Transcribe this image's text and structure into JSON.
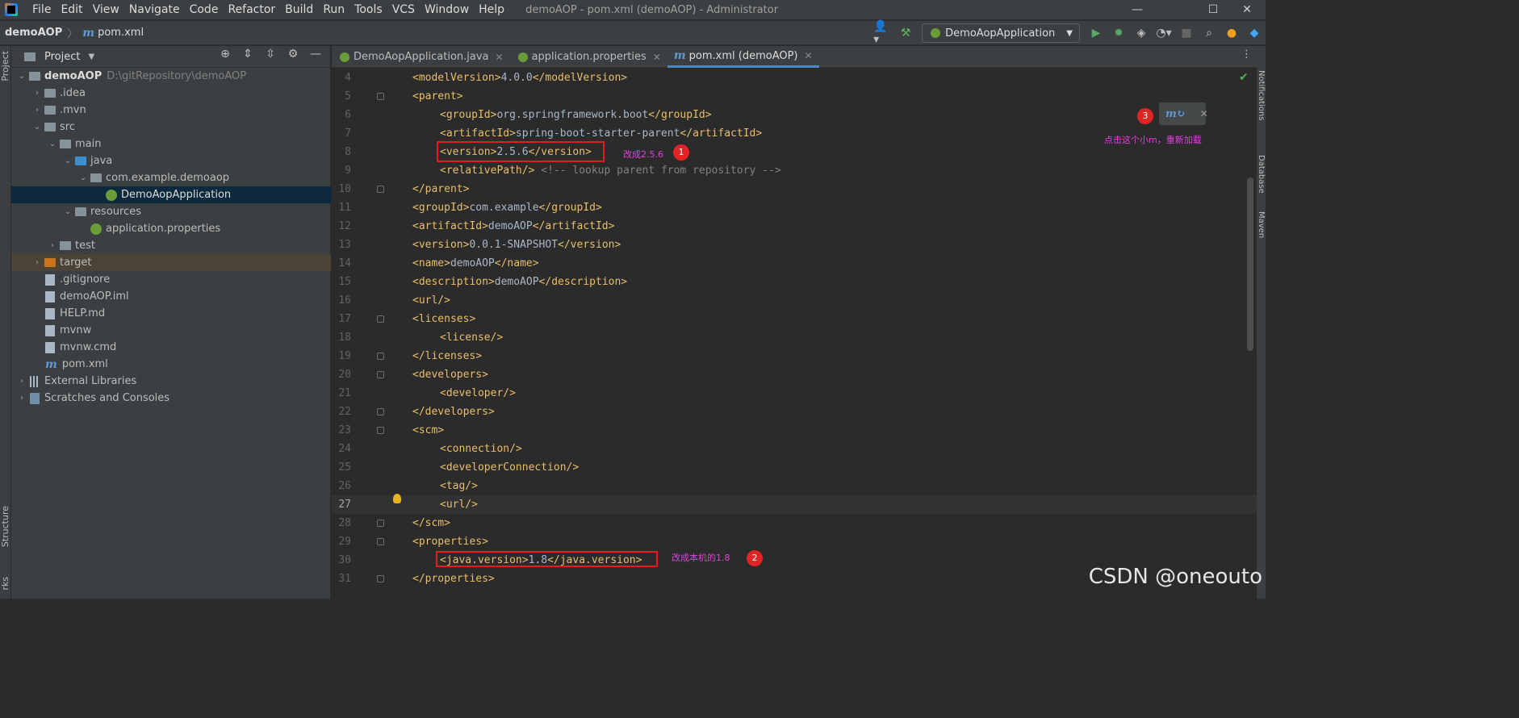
{
  "menubar": {
    "items": [
      "File",
      "Edit",
      "View",
      "Navigate",
      "Code",
      "Refactor",
      "Build",
      "Run",
      "Tools",
      "VCS",
      "Window",
      "Help"
    ],
    "window_title": "demoAOP - pom.xml (demoAOP) - Administrator",
    "minimize": "—",
    "maximize": "☐",
    "close": "✕"
  },
  "navbar": {
    "project": "demoAOP",
    "file": "pom.xml",
    "run_config": "DemoAopApplication"
  },
  "project_panel": {
    "title": "Project",
    "tree": [
      {
        "label": "demoAOP",
        "hint": "D:\\gitRepository\\demoAOP",
        "depth": 0,
        "arrow": "down",
        "icon": "folder"
      },
      {
        "label": ".idea",
        "depth": 1,
        "arrow": "right",
        "icon": "folder"
      },
      {
        "label": ".mvn",
        "depth": 1,
        "arrow": "right",
        "icon": "folder"
      },
      {
        "label": "src",
        "depth": 1,
        "arrow": "down",
        "icon": "folder"
      },
      {
        "label": "main",
        "depth": 2,
        "arrow": "down",
        "icon": "folder"
      },
      {
        "label": "java",
        "depth": 3,
        "arrow": "down",
        "icon": "folder-blue"
      },
      {
        "label": "com.example.demoaop",
        "depth": 4,
        "arrow": "down",
        "icon": "folder"
      },
      {
        "label": "DemoAopApplication",
        "depth": 5,
        "arrow": "",
        "icon": "spring",
        "selected": true
      },
      {
        "label": "resources",
        "depth": 3,
        "arrow": "down",
        "icon": "folder"
      },
      {
        "label": "application.properties",
        "depth": 4,
        "arrow": "",
        "icon": "spring"
      },
      {
        "label": "test",
        "depth": 2,
        "arrow": "right",
        "icon": "folder"
      },
      {
        "label": "target",
        "depth": 1,
        "arrow": "right",
        "icon": "folder-orange",
        "excluded": true
      },
      {
        "label": ".gitignore",
        "depth": 1,
        "arrow": "",
        "icon": "file"
      },
      {
        "label": "demoAOP.iml",
        "depth": 1,
        "arrow": "",
        "icon": "file"
      },
      {
        "label": "HELP.md",
        "depth": 1,
        "arrow": "",
        "icon": "file"
      },
      {
        "label": "mvnw",
        "depth": 1,
        "arrow": "",
        "icon": "file"
      },
      {
        "label": "mvnw.cmd",
        "depth": 1,
        "arrow": "",
        "icon": "file"
      },
      {
        "label": "pom.xml",
        "depth": 1,
        "arrow": "",
        "icon": "maven"
      },
      {
        "label": "External Libraries",
        "depth": 0,
        "arrow": "right",
        "icon": "library"
      },
      {
        "label": "Scratches and Consoles",
        "depth": 0,
        "arrow": "right",
        "icon": "scratch"
      }
    ]
  },
  "left_strip": {
    "project": "Project",
    "structure": "Structure",
    "bookmarks": "rks"
  },
  "right_strip": {
    "notifications": "Notifications",
    "database": "Database",
    "maven": "Maven"
  },
  "editor_tabs": [
    {
      "label": "DemoAopApplication.java",
      "active": false
    },
    {
      "label": "application.properties",
      "active": false
    },
    {
      "label": "pom.xml (demoAOP)",
      "active": true
    }
  ],
  "code_lines": [
    {
      "n": "4",
      "text": "<modelVersion>4.0.0</modelVersion>",
      "indent": 0
    },
    {
      "n": "5",
      "text": "<parent>",
      "indent": 0
    },
    {
      "n": "6",
      "text": "<groupId>org.springframework.boot</groupId>",
      "indent": 1
    },
    {
      "n": "7",
      "text": "<artifactId>spring-boot-starter-parent</artifactId>",
      "indent": 1
    },
    {
      "n": "8",
      "text": "<version>2.5.6</version>",
      "indent": 1
    },
    {
      "n": "9",
      "text": "<relativePath/> <!-- lookup parent from repository -->",
      "indent": 1
    },
    {
      "n": "10",
      "text": "</parent>",
      "indent": 0
    },
    {
      "n": "11",
      "text": "<groupId>com.example</groupId>",
      "indent": 0
    },
    {
      "n": "12",
      "text": "<artifactId>demoAOP</artifactId>",
      "indent": 0
    },
    {
      "n": "13",
      "text": "<version>0.0.1-SNAPSHOT</version>",
      "indent": 0
    },
    {
      "n": "14",
      "text": "<name>demoAOP</name>",
      "indent": 0
    },
    {
      "n": "15",
      "text": "<description>demoAOP</description>",
      "indent": 0
    },
    {
      "n": "16",
      "text": "<url/>",
      "indent": 0
    },
    {
      "n": "17",
      "text": "<licenses>",
      "indent": 0
    },
    {
      "n": "18",
      "text": "<license/>",
      "indent": 1
    },
    {
      "n": "19",
      "text": "</licenses>",
      "indent": 0
    },
    {
      "n": "20",
      "text": "<developers>",
      "indent": 0
    },
    {
      "n": "21",
      "text": "<developer/>",
      "indent": 1
    },
    {
      "n": "22",
      "text": "</developers>",
      "indent": 0
    },
    {
      "n": "23",
      "text": "<scm>",
      "indent": 0
    },
    {
      "n": "24",
      "text": "<connection/>",
      "indent": 1
    },
    {
      "n": "25",
      "text": "<developerConnection/>",
      "indent": 1
    },
    {
      "n": "26",
      "text": "<tag/>",
      "indent": 1
    },
    {
      "n": "27",
      "text": "<url/>",
      "indent": 1,
      "current": true
    },
    {
      "n": "28",
      "text": "</scm>",
      "indent": 0
    },
    {
      "n": "29",
      "text": "<properties>",
      "indent": 0
    },
    {
      "n": "30",
      "text": "<java.version>1.8</java.version>",
      "indent": 1
    },
    {
      "n": "31",
      "text": "</properties>",
      "indent": 0
    }
  ],
  "annotations": {
    "note1": "改成2.5.6",
    "note2": "改成本机的1.8",
    "note3": "点击这个小m，重新加载",
    "badge1": "1",
    "badge2": "2",
    "badge3": "3"
  },
  "watermark": "CSDN @oneouto",
  "colors": {
    "tag": "#e8bf6a",
    "text": "#a9b7c6",
    "comment": "#808080",
    "annotation": "#e040e0",
    "badge": "#e02424"
  }
}
